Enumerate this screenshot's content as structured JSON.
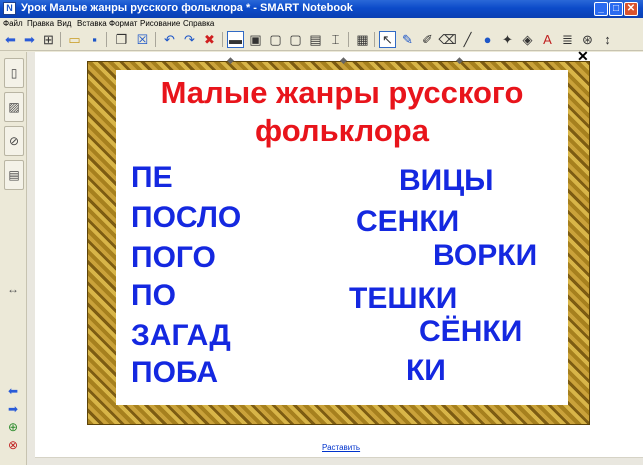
{
  "window": {
    "title": "Урок  Малые жанры русского фольклора *  - SMART Notebook",
    "min_label": "_",
    "max_label": "□",
    "close_label": "✕"
  },
  "menu": [
    "Файл",
    "Правка",
    "Вид",
    "Вставка",
    "Формат",
    "Рисование",
    "Справка"
  ],
  "toolbar": {
    "icons": [
      "back-icon",
      "forward-icon",
      "add-page-icon",
      "open-icon",
      "save-icon",
      "paste-icon",
      "delete-page-icon",
      "undo-icon",
      "redo-icon",
      "delete-icon",
      "screen-shade-icon",
      "full-screen-icon",
      "dual-display-icon",
      "display-icon",
      "capture-icon",
      "document-camera-icon",
      "table-icon",
      "select-icon",
      "pen-icon",
      "creative-pen-icon",
      "eraser-icon",
      "line-icon",
      "shape-icon",
      "magic-pen-icon",
      "fill-icon",
      "text-icon",
      "font-icon",
      "properties-icon",
      "more-icon"
    ]
  },
  "sidebar": {
    "tabs": [
      "page-sorter",
      "gallery",
      "attachments",
      "properties"
    ],
    "arrows": "↔"
  },
  "slide": {
    "title": "Малые жанры русского фольклора",
    "left_words": [
      "ПЕ",
      "ПОСЛО",
      "ПОГО",
      "ПО",
      "ЗАГАД",
      "ПОБА"
    ],
    "right_words": [
      "ВИЦЫ",
      "СЕНКИ",
      "ВОРКИ",
      "ТЕШКИ",
      "СЁНКИ",
      "КИ"
    ],
    "title_color": "#e8141b",
    "word_color": "#1428e0",
    "frame_close": "✕"
  },
  "link_text": "Раставить"
}
